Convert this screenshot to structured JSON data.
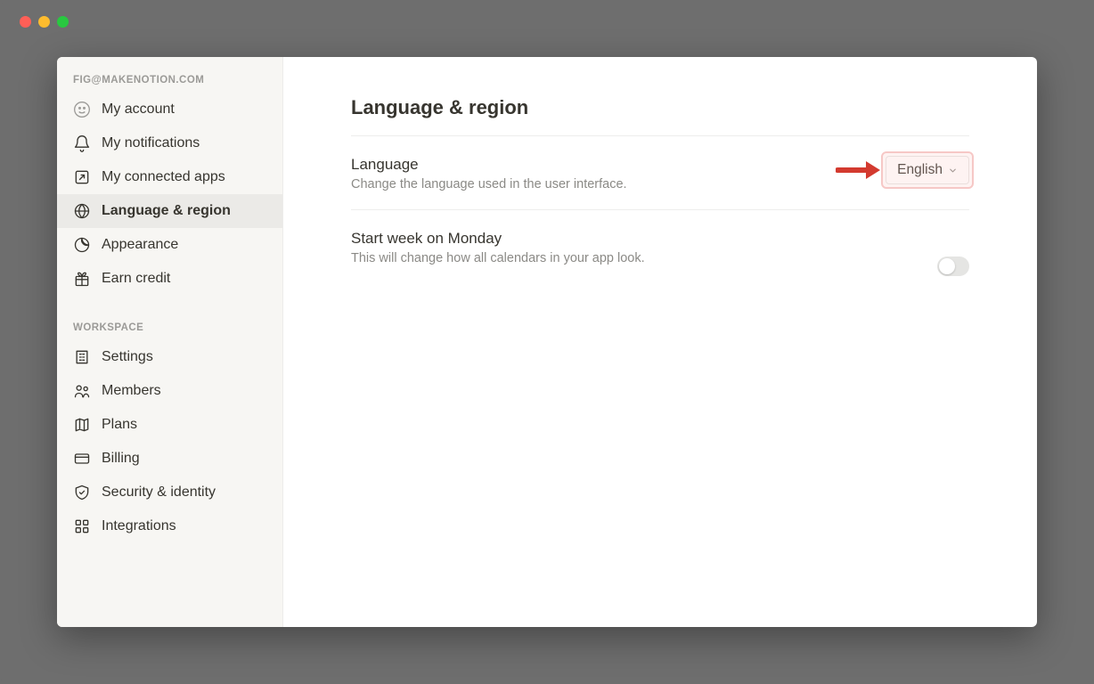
{
  "account_email": "FIG@MAKENOTION.COM",
  "sidebar": {
    "account_items": [
      {
        "label": "My account"
      },
      {
        "label": "My notifications"
      },
      {
        "label": "My connected apps"
      },
      {
        "label": "Language & region"
      },
      {
        "label": "Appearance"
      },
      {
        "label": "Earn credit"
      }
    ],
    "workspace_label": "WORKSPACE",
    "workspace_items": [
      {
        "label": "Settings"
      },
      {
        "label": "Members"
      },
      {
        "label": "Plans"
      },
      {
        "label": "Billing"
      },
      {
        "label": "Security & identity"
      },
      {
        "label": "Integrations"
      }
    ]
  },
  "page": {
    "title": "Language & region",
    "language": {
      "title": "Language",
      "desc": "Change the language used in the user interface.",
      "value": "English"
    },
    "week": {
      "title": "Start week on Monday",
      "desc": "This will change how all calendars in your app look.",
      "toggle_on": false
    }
  }
}
